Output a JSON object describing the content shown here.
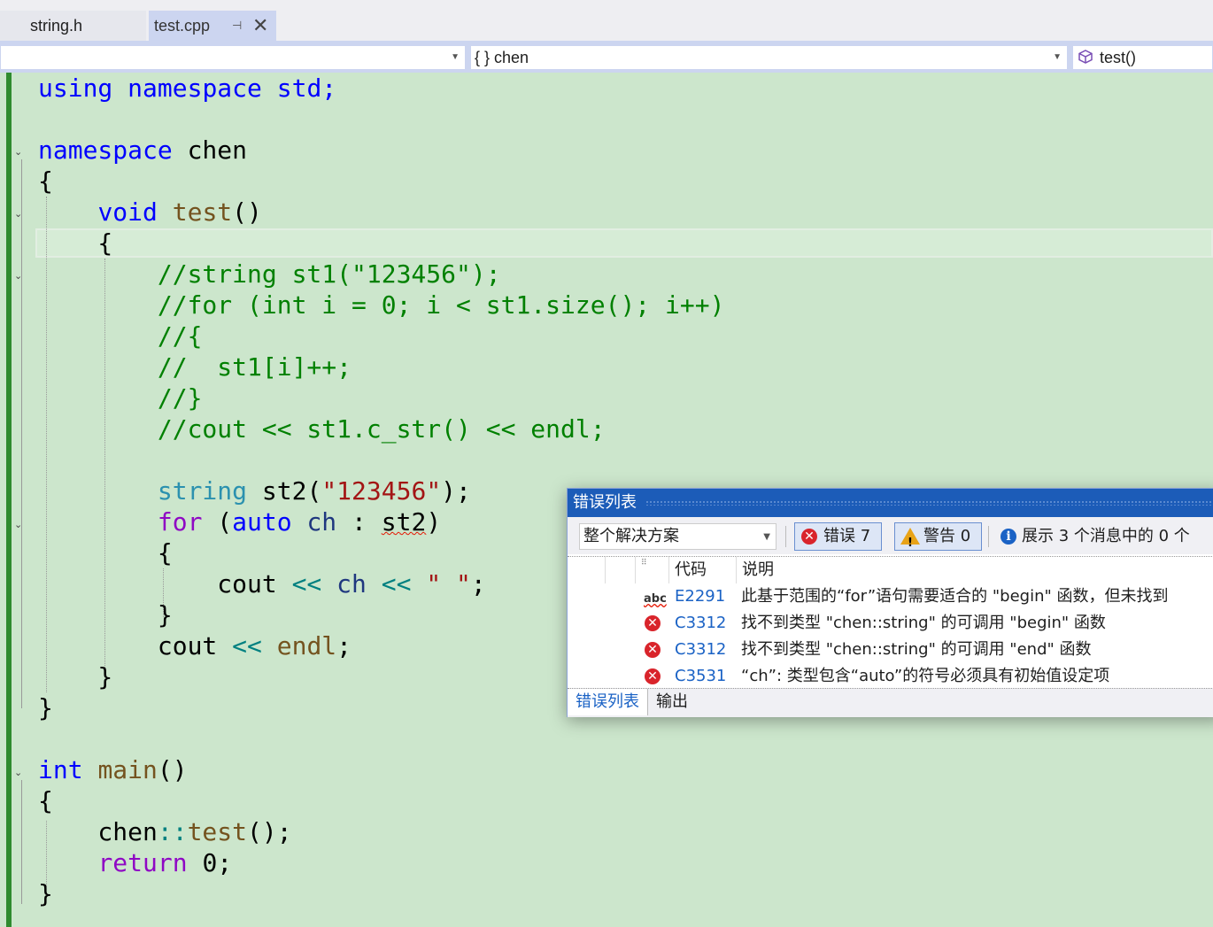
{
  "tabs": [
    {
      "label": "string.h",
      "active": false
    },
    {
      "label": "test.cpp",
      "active": true
    }
  ],
  "navbar": {
    "project": "",
    "scope": "{ } chen",
    "member": "test()"
  },
  "code_lines": [
    "using namespace std;",
    "",
    "namespace chen",
    "{",
    "    void test()",
    "    {",
    "        //string st1(\"123456\");",
    "        //for (int i = 0; i < st1.size(); i++)",
    "        //{",
    "        //  st1[i]++;",
    "        //}",
    "        //cout << st1.c_str() << endl;",
    "",
    "        string st2(\"123456\");",
    "        for (auto ch : st2)",
    "        {",
    "            cout << ch << \" \";",
    "        }",
    "        cout << endl;",
    "    }",
    "}",
    "",
    "int main()",
    "{",
    "    chen::test();",
    "    return 0;",
    "}"
  ],
  "error_list": {
    "title": "错误列表",
    "scope_filter": "整个解决方案",
    "errors_button": "错误 7",
    "warnings_button": "警告 0",
    "messages_button": "展示 3 个消息中的 0 个",
    "columns": {
      "code": "代码",
      "description": "说明"
    },
    "rows": [
      {
        "icon": "spell-check-icon",
        "code": "E2291",
        "description": "此基于范围的“for”语句需要适合的 \"begin\" 函数，但未找到"
      },
      {
        "icon": "error-icon",
        "code": "C3312",
        "description": "找不到类型 \"chen::string\" 的可调用 \"begin\" 函数"
      },
      {
        "icon": "error-icon",
        "code": "C3312",
        "description": "找不到类型 \"chen::string\" 的可调用 \"end\" 函数"
      },
      {
        "icon": "error-icon",
        "code": "C3531",
        "description": "“ch”: 类型包含“auto”的符号必须具有初始值设定项"
      }
    ],
    "bottom_tabs": [
      "错误列表",
      "输出"
    ]
  },
  "colors": {
    "editor_bg": "#cce6cc",
    "keyword": "#0000ff",
    "type": "#2b91af",
    "comment": "#008000",
    "string": "#a31515",
    "error": "#d9242b"
  }
}
